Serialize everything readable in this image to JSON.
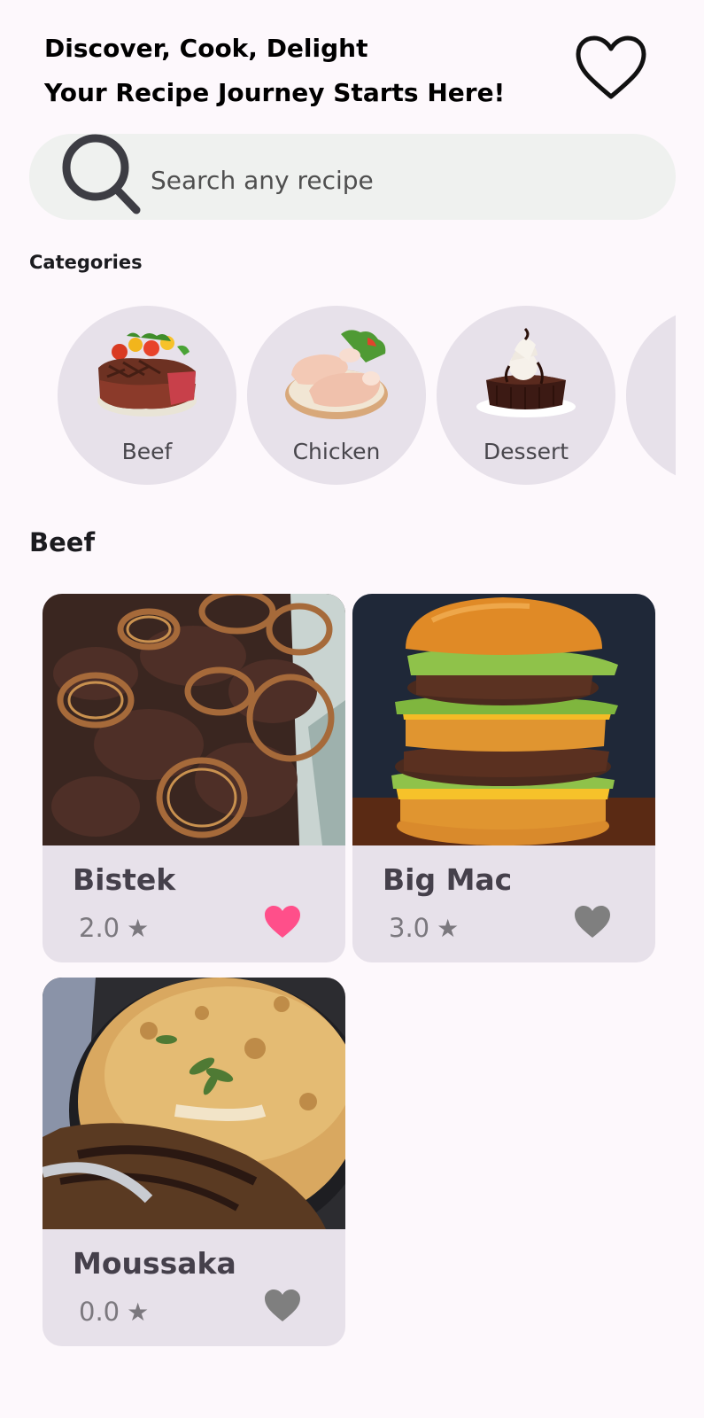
{
  "header": {
    "line1": "Discover, Cook, Delight",
    "line2": "Your Recipe Journey Starts Here!",
    "favorites_icon": "heart-outline-icon"
  },
  "search": {
    "placeholder": "Search any recipe",
    "icon": "search-icon"
  },
  "categories": {
    "label": "Categories",
    "items": [
      {
        "label": "Beef"
      },
      {
        "label": "Chicken"
      },
      {
        "label": "Dessert"
      },
      {
        "label": ""
      }
    ]
  },
  "selected_category": {
    "heading": "Beef"
  },
  "recipes": [
    {
      "name": "Bistek",
      "rating": "2.0",
      "star": "★",
      "favorited": true,
      "heart_color": "#ff4f8a"
    },
    {
      "name": "Big Mac",
      "rating": "3.0",
      "star": "★",
      "favorited": false,
      "heart_color": "#7f7f7f"
    },
    {
      "name": "Moussaka",
      "rating": "0.0",
      "star": "★",
      "favorited": false,
      "heart_color": "#7f7f7f"
    }
  ],
  "colors": {
    "background": "#fdf8fc",
    "card_background": "#e7e1ea",
    "search_background": "#eff1ef",
    "favorite_active": "#ff4f8a",
    "favorite_inactive": "#7f7f7f"
  }
}
